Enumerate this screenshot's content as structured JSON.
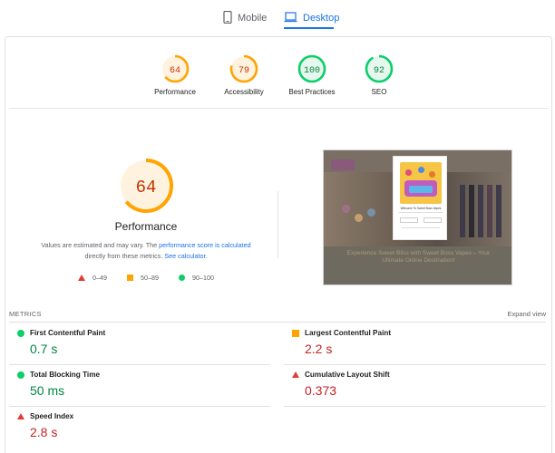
{
  "tabs": {
    "mobile": {
      "label": "Mobile",
      "icon": "smartphone-icon"
    },
    "desktop": {
      "label": "Desktop",
      "icon": "laptop-icon",
      "active": true
    }
  },
  "gauges": [
    {
      "name": "Performance",
      "score": "64",
      "value": 64,
      "status": "average"
    },
    {
      "name": "Accessibility",
      "score": "79",
      "value": 79,
      "status": "average"
    },
    {
      "name": "Best Practices",
      "score": "100",
      "value": 100,
      "status": "pass"
    },
    {
      "name": "SEO",
      "score": "92",
      "value": 92,
      "status": "pass"
    }
  ],
  "colors": {
    "average": "#ffa400",
    "average_text": "#c33300",
    "average_bg": "#fff3e0",
    "pass": "#0cce6b",
    "pass_text": "#018642",
    "pass_bg": "#e6f7ed",
    "fail": "#ff4e42",
    "accent": "#1a73e8"
  },
  "performance": {
    "score": "64",
    "value": 64,
    "title": "Performance",
    "note_prefix": "Values are estimated and may vary. The ",
    "note_link1": "performance score is calculated",
    "note_mid": "directly from these metrics. ",
    "note_link2": "See calculator.",
    "legend": [
      {
        "symbol": "triangle",
        "range": "0–49"
      },
      {
        "symbol": "square",
        "range": "50–89"
      },
      {
        "symbol": "circle",
        "range": "90–100"
      }
    ]
  },
  "thumbnail": {
    "modal_title": "Welcome To Sweet Boss Vapes",
    "caption": "Experience Sweet Bliss with Sweet Boss Vapes – Your Ultimate Online Destination!"
  },
  "metrics": {
    "heading": "METRICS",
    "expand_label": "Expand view",
    "items": [
      {
        "name": "First Contentful Paint",
        "value": "0.7 s",
        "status": "pass"
      },
      {
        "name": "Largest Contentful Paint",
        "value": "2.2 s",
        "status": "average"
      },
      {
        "name": "Total Blocking Time",
        "value": "50 ms",
        "status": "pass"
      },
      {
        "name": "Cumulative Layout Shift",
        "value": "0.373",
        "status": "fail"
      },
      {
        "name": "Speed Index",
        "value": "2.8 s",
        "status": "fail"
      }
    ]
  }
}
